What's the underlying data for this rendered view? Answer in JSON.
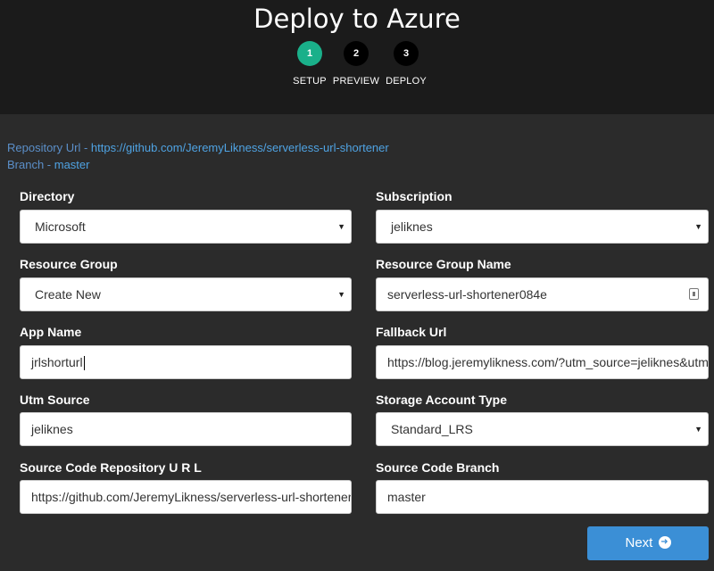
{
  "header": {
    "title": "Deploy to Azure",
    "steps": [
      {
        "number": "1",
        "label": "SETUP"
      },
      {
        "number": "2",
        "label": "PREVIEW"
      },
      {
        "number": "3",
        "label": "DEPLOY"
      }
    ],
    "active_step_color": "#1ab08a"
  },
  "repo": {
    "url_label": "Repository Url - ",
    "url": "https://github.com/JeremyLikness/serverless-url-shortener",
    "branch_label": "Branch - ",
    "branch": "master"
  },
  "form": {
    "directory": {
      "label": "Directory",
      "value": "Microsoft"
    },
    "subscription": {
      "label": "Subscription",
      "value": "jeliknes"
    },
    "resource_group": {
      "label": "Resource Group",
      "value": "Create New"
    },
    "resource_group_name": {
      "label": "Resource Group Name",
      "value": "serverless-url-shortener084e"
    },
    "app_name": {
      "label": "App Name",
      "value": "jrlshorturl"
    },
    "fallback_url": {
      "label": "Fallback Url",
      "value": "https://blog.jeremylikness.com/?utm_source=jeliknes&utm_medium=redirect"
    },
    "utm_source": {
      "label": "Utm Source",
      "value": "jeliknes"
    },
    "storage_account_type": {
      "label": "Storage Account Type",
      "value": "Standard_LRS"
    },
    "source_repo_url": {
      "label": "Source Code Repository U R L",
      "value": "https://github.com/JeremyLikness/serverless-url-shortener"
    },
    "source_branch": {
      "label": "Source Code Branch",
      "value": "master"
    }
  },
  "actions": {
    "next_label": "Next",
    "accent": "#3b8fd6"
  }
}
